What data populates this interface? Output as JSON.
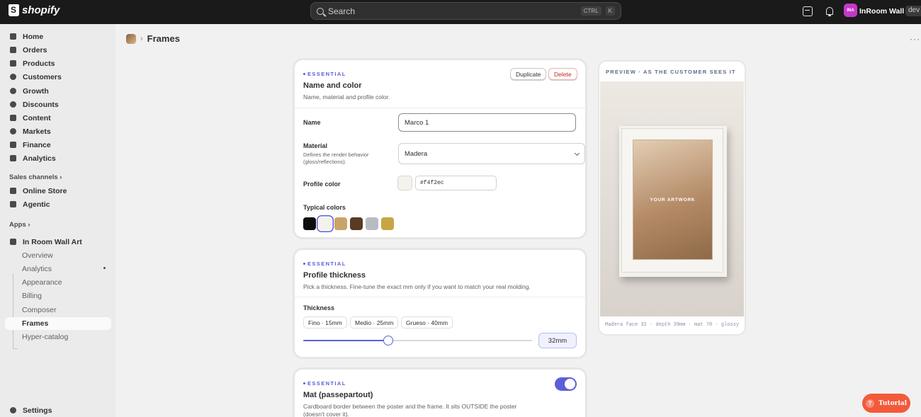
{
  "topbar": {
    "logo_text": "shopify",
    "search_placeholder": "Search",
    "shortcut_ctrl": "CTRL",
    "shortcut_key": "K",
    "avatar_initials": "INA",
    "store_name": "InRoom Wall Art",
    "store_badge": "dev"
  },
  "sidebar": {
    "items": [
      {
        "label": "Home",
        "icon": "home-icon"
      },
      {
        "label": "Orders",
        "icon": "orders-icon"
      },
      {
        "label": "Products",
        "icon": "tag-icon"
      },
      {
        "label": "Customers",
        "icon": "person-icon"
      },
      {
        "label": "Growth",
        "icon": "growth-icon"
      },
      {
        "label": "Discounts",
        "icon": "discount-icon"
      },
      {
        "label": "Content",
        "icon": "content-icon"
      },
      {
        "label": "Markets",
        "icon": "globe-icon"
      },
      {
        "label": "Finance",
        "icon": "bank-icon"
      },
      {
        "label": "Analytics",
        "icon": "bar-chart-icon"
      }
    ],
    "sales_channels_label": "Sales channels",
    "channels": [
      {
        "label": "Online Store",
        "icon": "store-icon"
      },
      {
        "label": "Agentic",
        "icon": "agentic-icon"
      }
    ],
    "apps_label": "Apps",
    "app_name": "In Room Wall Art",
    "app_subitems": [
      "Overview",
      "Analytics",
      "Appearance",
      "Billing",
      "Composer",
      "Frames",
      "Hyper-catalog"
    ],
    "settings_label": "Settings"
  },
  "page": {
    "title": "Frames"
  },
  "name_card": {
    "tag": "ESSENTIAL",
    "title": "Name and color",
    "subtitle": "Name, material and profile color.",
    "duplicate_label": "Duplicate",
    "delete_label": "Delete",
    "name_label": "Name",
    "name_value": "Marco 1",
    "material_label": "Material",
    "material_hint": "Defines the render behavior (gloss/reflections).",
    "material_value": "Madera",
    "profile_color_label": "Profile color",
    "profile_color_value": "#f4f2ec",
    "typical_colors_label": "Typical colors",
    "typical_colors": [
      "#0e0e0e",
      "#f4f2ec",
      "#c9a468",
      "#5a3a22",
      "#b8bcc2",
      "#c9a545"
    ]
  },
  "thickness_card": {
    "tag": "ESSENTIAL",
    "title": "Profile thickness",
    "subtitle": "Pick a thickness. Fine-tune the exact mm only if you want to match your real molding.",
    "thickness_label": "Thickness",
    "presets": [
      "Fino · 15mm",
      "Medio · 25mm",
      "Grueso · 40mm"
    ],
    "value_label": "32mm",
    "slider_fraction": 0.37
  },
  "mat_card": {
    "tag": "ESSENTIAL",
    "title": "Mat (passepartout)",
    "subtitle": "Cardboard border between the poster and the frame. It sits OUTSIDE the poster (doesn't cover it).",
    "enabled": true
  },
  "preview": {
    "title": "PREVIEW · AS THE CUSTOMER SEES IT",
    "artwork_label": "YOUR ARTWORK",
    "caption": "Madera  face 32 · depth 39mm · mat 70 · glossy"
  },
  "tutorial_label": "Tutorial",
  "colors": {
    "accent": "#5b5fd9",
    "danger": "#c4271a",
    "tutorial": "#f35a3a"
  }
}
